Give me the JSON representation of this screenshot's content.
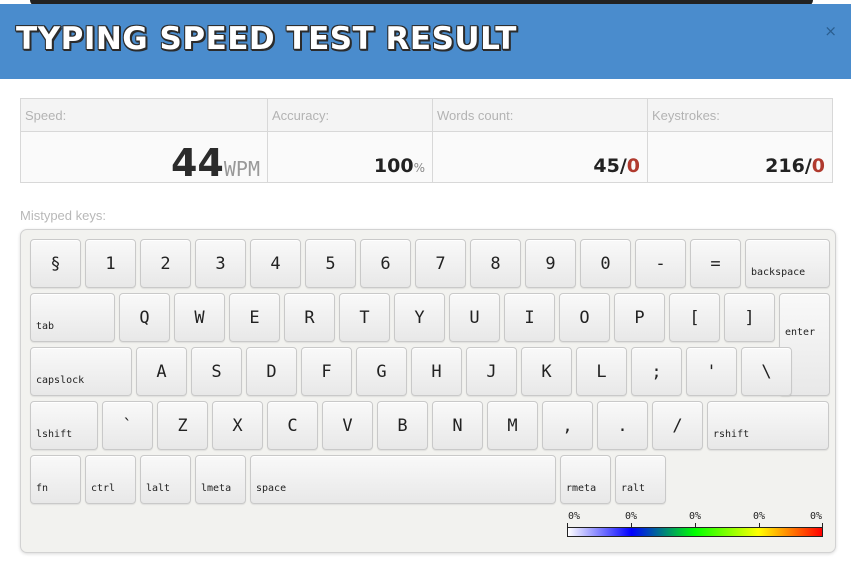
{
  "header": {
    "title": "TYPING SPEED TEST RESULT",
    "close_label": "×"
  },
  "stats": {
    "speed": {
      "label": "Speed:",
      "value": "44",
      "unit": "WPM"
    },
    "accuracy": {
      "label": "Accuracy:",
      "value": "100",
      "unit": "%"
    },
    "words": {
      "label": "Words count:",
      "value": "45",
      "sep": "/",
      "errors": "0"
    },
    "keystrokes": {
      "label": "Keystrokes:",
      "value": "216",
      "sep": "/",
      "errors": "0"
    }
  },
  "keyboard": {
    "label": "Mistyped keys:",
    "rows": [
      [
        "§",
        "1",
        "2",
        "3",
        "4",
        "5",
        "6",
        "7",
        "8",
        "9",
        "0",
        "-",
        "=",
        "backspace"
      ],
      [
        "tab",
        "Q",
        "W",
        "E",
        "R",
        "T",
        "Y",
        "U",
        "I",
        "O",
        "P",
        "[",
        "]",
        "enter"
      ],
      [
        "capslock",
        "A",
        "S",
        "D",
        "F",
        "G",
        "H",
        "J",
        "K",
        "L",
        ";",
        "'",
        "\\"
      ],
      [
        "lshift",
        "`",
        "Z",
        "X",
        "C",
        "V",
        "B",
        "N",
        "M",
        ",",
        ".",
        "/",
        "rshift"
      ],
      [
        "fn",
        "ctrl",
        "lalt",
        "lmeta",
        "space",
        "rmeta",
        "ralt"
      ]
    ]
  },
  "legend": {
    "labels": [
      "0%",
      "0%",
      "0%",
      "0%",
      "0%"
    ]
  },
  "colors": {
    "header": "#4a8ccd",
    "error": "#b03a2e"
  }
}
